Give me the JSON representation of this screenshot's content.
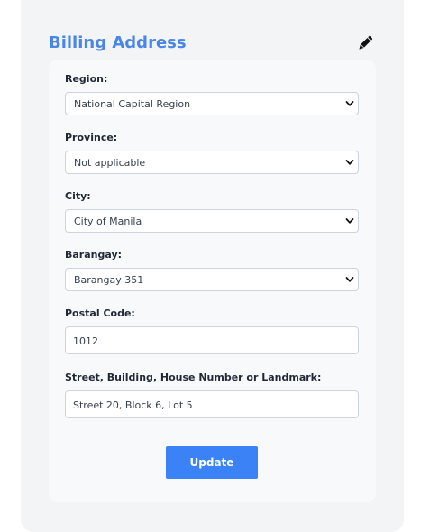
{
  "billing": {
    "title": "Billing Address",
    "edit_icon": "pencil-icon",
    "fields": {
      "region": {
        "label": "Region:",
        "value": "National Capital Region"
      },
      "province": {
        "label": "Province:",
        "value": "Not applicable"
      },
      "city": {
        "label": "City:",
        "value": "City of Manila"
      },
      "barangay": {
        "label": "Barangay:",
        "value": "Barangay 351"
      },
      "postal_code": {
        "label": "Postal Code:",
        "value": "1012"
      },
      "street": {
        "label": "Street, Building, House Number or Landmark:",
        "value": "Street 20, Block 6, Lot 5"
      }
    },
    "update_label": "Update"
  },
  "colors": {
    "accent": "#4a86e8",
    "button": "#3b82f6",
    "panel_bg": "#f3f4f6",
    "card_bg": "#f8f9fb"
  }
}
